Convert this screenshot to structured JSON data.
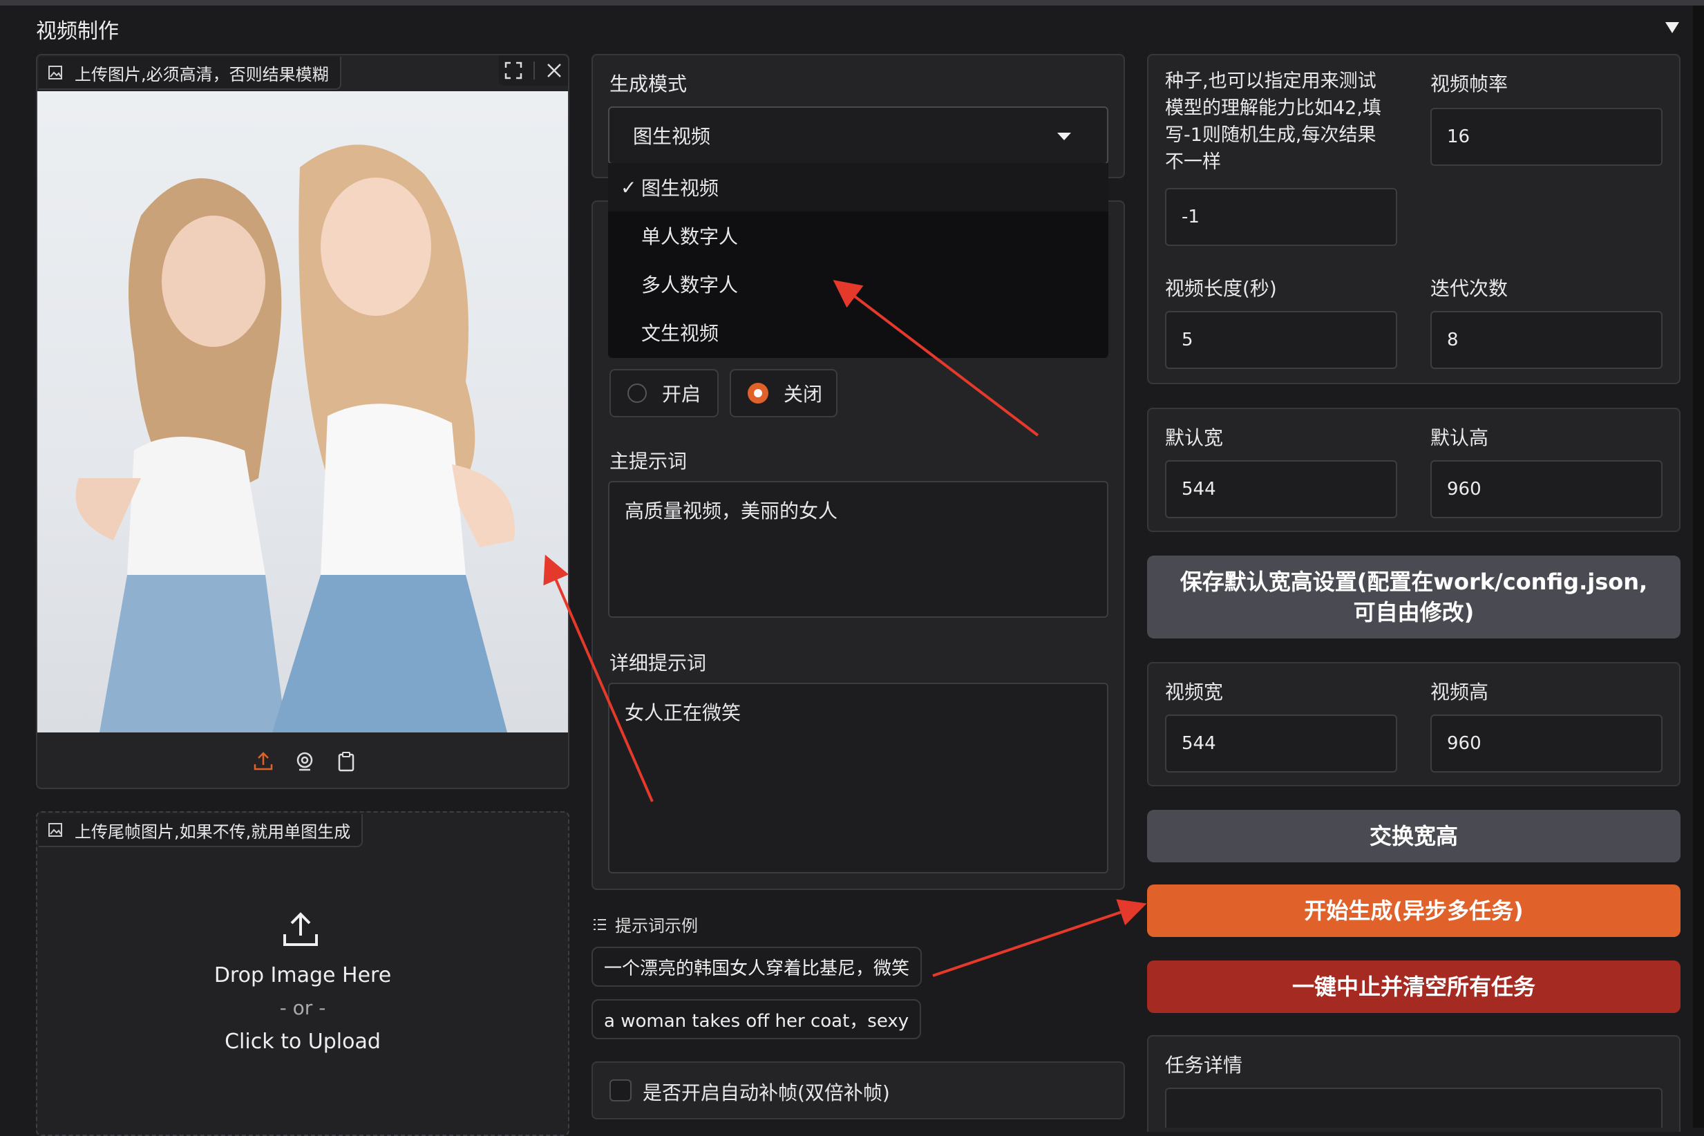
{
  "header": {
    "title": "视频制作",
    "collapse_icon": "caret-down-icon"
  },
  "upload_main": {
    "label": "上传图片,必须高清，否则结果模糊",
    "icons": [
      "image-icon",
      "fullscreen-icon",
      "close-icon",
      "upload-icon",
      "webcam-icon",
      "clipboard-icon"
    ]
  },
  "upload_tail": {
    "label": "上传尾帧图片,如果不传,就用单图生成",
    "drop_text": "Drop Image Here",
    "or_text": "- or -",
    "click_text": "Click to Upload"
  },
  "mode": {
    "label": "生成模式",
    "selected": "图生视频",
    "options": [
      {
        "label": "图生视频",
        "checked": true,
        "check": "✓"
      },
      {
        "label": "单人数字人",
        "checked": false,
        "check": ""
      },
      {
        "label": "多人数字人",
        "checked": false,
        "check": ""
      },
      {
        "label": "文生视频",
        "checked": false,
        "check": ""
      }
    ]
  },
  "toggle": {
    "on_label": "开启",
    "off_label": "关闭",
    "selected": "关闭"
  },
  "prompts": {
    "main_label": "主提示词",
    "main_value": "高质量视频，美丽的女人",
    "detail_label": "详细提示词",
    "detail_value": "女人正在微笑"
  },
  "examples": {
    "label": "提示词示例",
    "items": [
      "一个漂亮的韩国女人穿着比基尼，微笑",
      "a woman takes off her coat，sexy"
    ]
  },
  "interp": {
    "label": "是否开启自动补帧(双倍补帧)",
    "checked": false
  },
  "seed": {
    "label": "种子,也可以指定用来测试模型的理解能力比如42,填写-1则随机生成,每次结果不一样",
    "value": "-1"
  },
  "fps": {
    "label": "视频帧率",
    "value": "16"
  },
  "duration": {
    "label": "视频长度(秒)",
    "value": "5"
  },
  "steps": {
    "label": "迭代次数",
    "value": "8"
  },
  "default_w": {
    "label": "默认宽",
    "value": "544"
  },
  "default_h": {
    "label": "默认高",
    "value": "960"
  },
  "save_btn": "保存默认宽高设置(配置在work/config.json,可自由修改)",
  "video_w": {
    "label": "视频宽",
    "value": "544"
  },
  "video_h": {
    "label": "视频高",
    "value": "960"
  },
  "swap_btn": "交换宽高",
  "start_btn": "开始生成(异步多任务)",
  "stop_btn": "一键中止并清空所有任务",
  "task": {
    "label": "任务详情"
  },
  "colors": {
    "accent": "#e0622a",
    "danger": "#a52b22",
    "secondary": "#4a4a52",
    "arrow": "#e5392b"
  }
}
